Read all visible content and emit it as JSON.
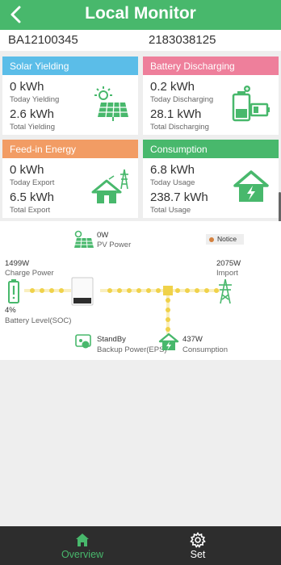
{
  "header": {
    "title": "Local Monitor"
  },
  "device": {
    "id_left": "BA12100345",
    "id_right": "2183038125"
  },
  "cards": {
    "solar": {
      "title": "Solar Yielding",
      "color": "#5bbde8",
      "value1": "0 kWh",
      "label1": "Today Yielding",
      "value2": "2.6 kWh",
      "label2": "Total Yielding"
    },
    "battery": {
      "title": "Battery Discharging",
      "color": "#ee7f9b",
      "value1": "0.2 kWh",
      "label1": "Today Discharging",
      "value2": "28.1 kWh",
      "label2": "Total Discharging"
    },
    "feedin": {
      "title": "Feed-in Energy",
      "color": "#f29c64",
      "value1": "0 kWh",
      "label1": "Today Export",
      "value2": "6.5 kWh",
      "label2": "Total Export"
    },
    "consumption": {
      "title": "Consumption",
      "color": "#48b86c",
      "value1": "6.8 kWh",
      "label1": "Today Usage",
      "value2": "238.7 kWh",
      "label2": "Total Usage"
    }
  },
  "flow": {
    "pv": {
      "value": "0W",
      "label": "PV Power"
    },
    "notice": "Notice",
    "charge": {
      "value": "1499W",
      "label": "Charge Power"
    },
    "grid": {
      "value": "2075W",
      "label": "Import"
    },
    "soc": {
      "value": "4%",
      "label": "Battery Level(SOC)"
    },
    "backup": {
      "value": "StandBy",
      "label": "Backup Power(EPS)"
    },
    "load": {
      "value": "437W",
      "label": "Consumption"
    }
  },
  "tabs": [
    {
      "label": "Overview",
      "active": true
    },
    {
      "label": "Set",
      "active": false
    }
  ],
  "colors": {
    "brand": "#48b86c",
    "flow_dot": "#f0d24a",
    "tabbar": "#2d2d2d",
    "notice_dot": "#d4813e"
  }
}
